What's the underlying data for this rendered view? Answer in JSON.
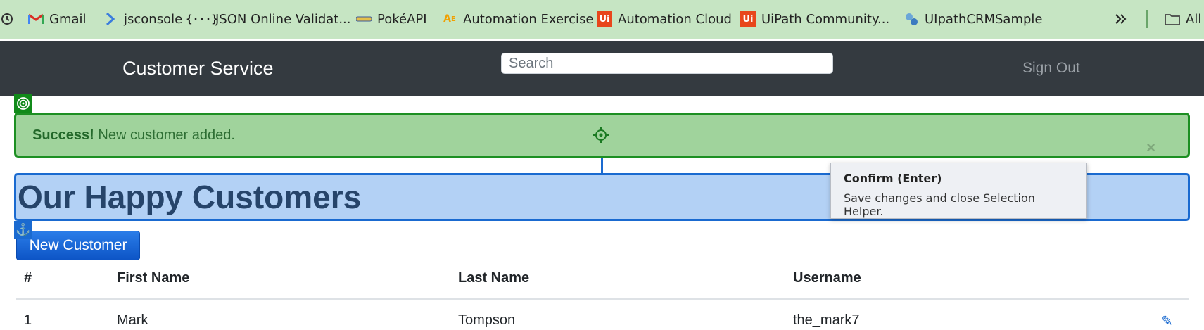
{
  "bookmarks": [
    {
      "label": "Gmail",
      "icon": "gmail-icon"
    },
    {
      "label": "jsconsole",
      "icon": "chevron-right-icon"
    },
    {
      "label": "JSON Online Validat...",
      "icon": "json-braces-icon"
    },
    {
      "label": "PokéAPI",
      "icon": "pokeapi-icon"
    },
    {
      "label": "Automation Exercise",
      "icon": "automation-exercise-icon"
    },
    {
      "label": "Automation Cloud",
      "icon": "uipath-icon"
    },
    {
      "label": "UiPath Community...",
      "icon": "uipath-icon"
    },
    {
      "label": "UIpathCRMSample",
      "icon": "crm-sample-icon"
    },
    {
      "label": "All",
      "icon": "folder-icon"
    }
  ],
  "navbar": {
    "brand": "Customer Service",
    "search_placeholder": "Search",
    "signout": "Sign Out"
  },
  "alert": {
    "strong": "Success!",
    "message": "New customer added.",
    "close": "×"
  },
  "page": {
    "heading": "Our Happy Customers",
    "new_button": "New Customer"
  },
  "tooltip": {
    "title": "Confirm (Enter)",
    "description": "Save changes and close Selection Helper."
  },
  "table": {
    "headers": [
      "#",
      "First Name",
      "Last Name",
      "Username"
    ],
    "rows": [
      {
        "num": "1",
        "first": "Mark",
        "last": "Tompson",
        "username": "the_mark7"
      }
    ]
  },
  "colors": {
    "bookmark_bar": "#c6e5c3",
    "navbar": "#343a40",
    "alert_bg": "#a0d39c",
    "alert_border": "#1c8f22",
    "heading_highlight": "#b3d1f5",
    "highlight_border": "#1a6ad0",
    "primary_button": "#0d55c6"
  }
}
